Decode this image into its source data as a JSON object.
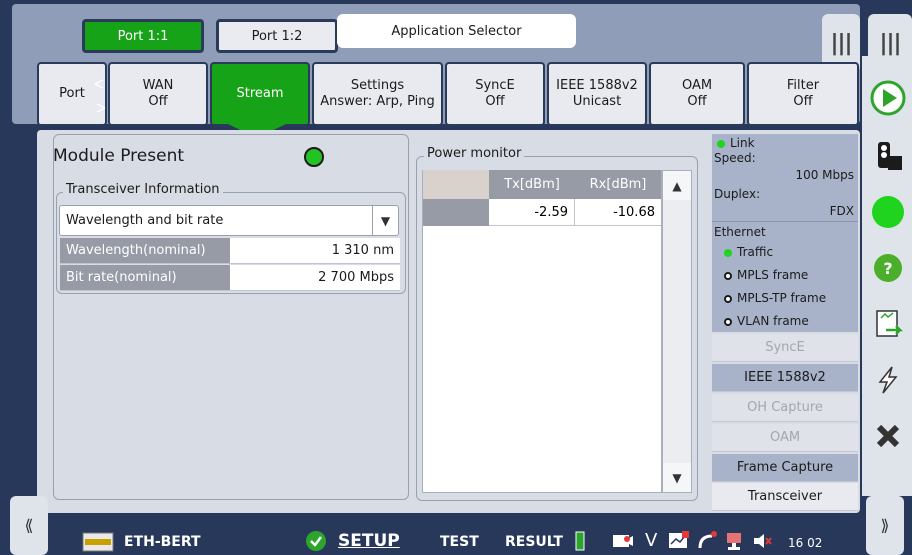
{
  "port_tabs": [
    {
      "label": "Port 1:1",
      "active": true
    },
    {
      "label": "Port 1:2",
      "active": false
    }
  ],
  "app_selector_label": "Application Selector",
  "top_menu_glyph": "|||",
  "func_tabs": {
    "port": {
      "line1": "Port"
    },
    "wan": {
      "line1": "WAN",
      "line2": "Off"
    },
    "stream": {
      "line1": "Stream"
    },
    "settings": {
      "line1": "Settings",
      "line2": "Answer: Arp, Ping"
    },
    "synce": {
      "line1": "SyncE",
      "line2": "Off"
    },
    "ieee": {
      "line1": "IEEE 1588v2",
      "line2": "Unicast"
    },
    "oam": {
      "line1": "OAM",
      "line2": "Off"
    },
    "filter": {
      "line1": "Filter",
      "line2": "Off"
    }
  },
  "module": {
    "title": "Module Present",
    "status_color": "#22c322"
  },
  "transceiver": {
    "group_label": "Transceiver Information",
    "dropdown_value": "Wavelength and bit rate",
    "rows": [
      {
        "key": "Wavelength(nominal)",
        "value": "1 310 nm"
      },
      {
        "key": "Bit rate(nominal)",
        "value": "2 700 Mbps"
      }
    ]
  },
  "power_monitor": {
    "group_label": "Power monitor",
    "headers": {
      "tx": "Tx[dBm]",
      "rx": "Rx[dBm]"
    },
    "rows": [
      {
        "tx": "-2.59",
        "rx": "-10.68"
      }
    ]
  },
  "link_status": {
    "link_label": "Link",
    "speed_label": "Speed:",
    "speed_value": "100 Mbps",
    "duplex_label": "Duplex:",
    "duplex_value": "FDX",
    "ethernet_label": "Ethernet",
    "ethernet_items": [
      {
        "label": "Traffic",
        "state": "green"
      },
      {
        "label": "MPLS frame",
        "state": "ring"
      },
      {
        "label": "MPLS-TP frame",
        "state": "ring"
      },
      {
        "label": "VLAN frame",
        "state": "ring"
      }
    ]
  },
  "side_buttons": [
    {
      "label": "SyncE",
      "style": "dim"
    },
    {
      "label": "IEEE 1588v2",
      "style": "on"
    },
    {
      "label": "OH Capture",
      "style": "dim"
    },
    {
      "label": "OAM",
      "style": "dim"
    },
    {
      "label": "Frame Capture",
      "style": "on"
    },
    {
      "label": "Transceiver",
      "style": "plain"
    }
  ],
  "bottom_bar": {
    "app_name": "ETH-BERT",
    "setup": "SETUP",
    "test": "TEST",
    "result": "RESULT",
    "v_label": "V",
    "clock": "16 02",
    "left_arrow": "⟪",
    "right_arrow": "⟫"
  },
  "colors": {
    "accent_green": "#17a317",
    "frame_navy": "#27385a",
    "panel_gray": "#d8dce4"
  }
}
